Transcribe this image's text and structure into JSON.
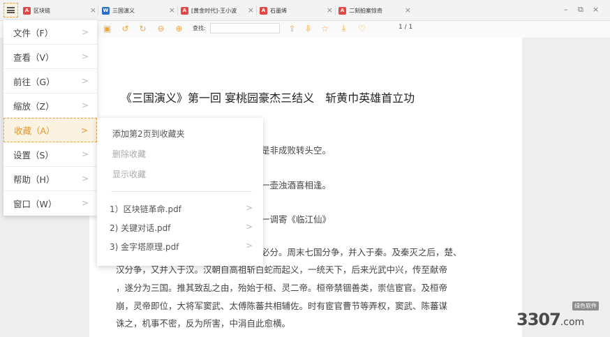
{
  "tabs": [
    {
      "label": "区块链",
      "icon": "pdf-file-icon"
    },
    {
      "label": "三国演义",
      "icon": "word-file-icon"
    },
    {
      "label": "[黄金时代]-王小波",
      "icon": "pdf-file-icon"
    },
    {
      "label": "石墨烯",
      "icon": "pdf-file-icon"
    },
    {
      "label": "二刻拍案惊奇",
      "icon": "pdf-file-icon"
    }
  ],
  "window_controls": {
    "minimize": "–",
    "restore": "⧉",
    "close": "×"
  },
  "toolbar": {
    "search_label": "查找:",
    "search_value": "",
    "page_indicator": "1 / 1"
  },
  "menu": {
    "items": [
      {
        "label": "文件（F）"
      },
      {
        "label": "查看（V）"
      },
      {
        "label": "前往（G）"
      },
      {
        "label": "缩放（Z）"
      },
      {
        "label": "收藏（A）"
      },
      {
        "label": "设置（S）"
      },
      {
        "label": "帮助（H）"
      },
      {
        "label": "窗口（W）"
      }
    ]
  },
  "submenu": {
    "add": "添加第2页到收藏夹",
    "delete": "删除收藏",
    "show": "显示收藏",
    "files": [
      {
        "label": "1）区块链革命.pdf"
      },
      {
        "label": "2) 关键对话.pdf"
      },
      {
        "label": "3) 金字塔原理.pdf"
      }
    ]
  },
  "document": {
    "title": "《三国演义》第一回 宴桃园豪杰三结义　斩黄巾英雄首立功",
    "lines": [
      "是非成败转头空。",
      "一壶浊酒喜相逢。",
      "一调寄《临江仙》",
      "必分。周末七国分争，并入于秦。及秦灭之后，楚、",
      "汉分争，又并入于汉。汉朝自高祖斩白蛇而起义，一统天下，后来光武中兴，传至献帝",
      "，遂分为三国。推其致乱之由，殆始于桓、灵二帝。桓帝禁锢善类，崇信宦官。及桓帝",
      "崩，灵帝即位，大将军窦武、太傅陈蕃共相辅佐。时有宦官曹节等弄权，窦武、陈蕃谋",
      "诛之，机事不密，反为所害，中涓自此愈横。"
    ]
  },
  "watermark": {
    "badge": "绿色软件",
    "logo": "3307",
    "suffix": ".com"
  }
}
